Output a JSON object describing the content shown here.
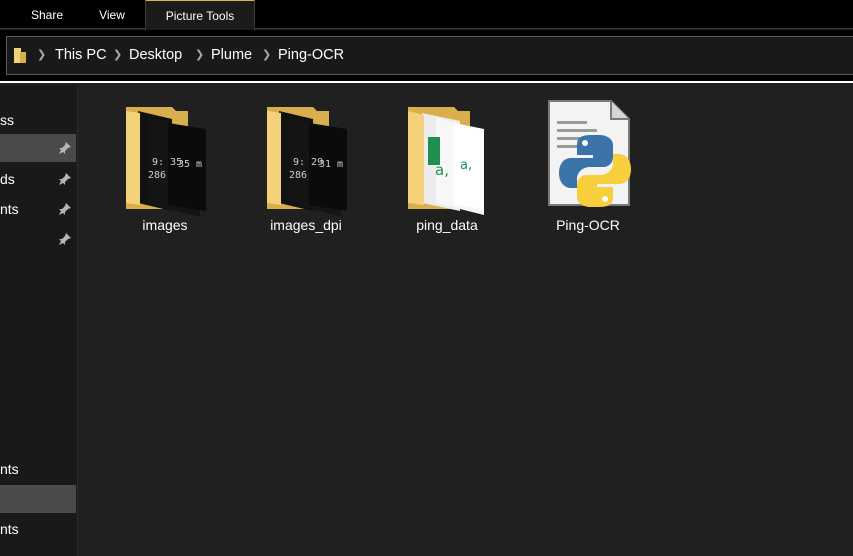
{
  "ribbon": {
    "tabs": [
      {
        "label": "Share"
      },
      {
        "label": "View"
      },
      {
        "label": "Picture Tools"
      }
    ]
  },
  "address": {
    "crumbs": [
      "This PC",
      "Desktop",
      "Plume",
      "Ping-OCR"
    ]
  },
  "nav": {
    "items": [
      {
        "label": "ss",
        "pinned": false,
        "selected": false
      },
      {
        "label": "",
        "pinned": true,
        "selected": true
      },
      {
        "label": "ds",
        "pinned": true,
        "selected": false
      },
      {
        "label": "nts",
        "pinned": true,
        "selected": false
      },
      {
        "label": "",
        "pinned": true,
        "selected": false
      },
      {
        "label": "nts",
        "pinned": false,
        "selected": false
      },
      {
        "label": "",
        "pinned": false,
        "selected": true
      },
      {
        "label": "nts",
        "pinned": false,
        "selected": false
      }
    ]
  },
  "files": [
    {
      "name": "images",
      "type": "folder-images",
      "thumb_text": [
        "9: 35",
        "286",
        "35 m"
      ]
    },
    {
      "name": "images_dpi",
      "type": "folder-images",
      "thumb_text": [
        "9: 29",
        "286",
        "31 m"
      ]
    },
    {
      "name": "ping_data",
      "type": "folder-excel",
      "thumb_text": [
        "a,",
        "a,"
      ]
    },
    {
      "name": "Ping-OCR",
      "type": "python-file",
      "thumb_text": []
    }
  ],
  "colors": {
    "folder": "#f4d27a",
    "folder_dark": "#d9ae4c",
    "excel_green": "#1e8f4e",
    "python_blue": "#3b74a8",
    "python_yellow": "#f7cf3c"
  }
}
